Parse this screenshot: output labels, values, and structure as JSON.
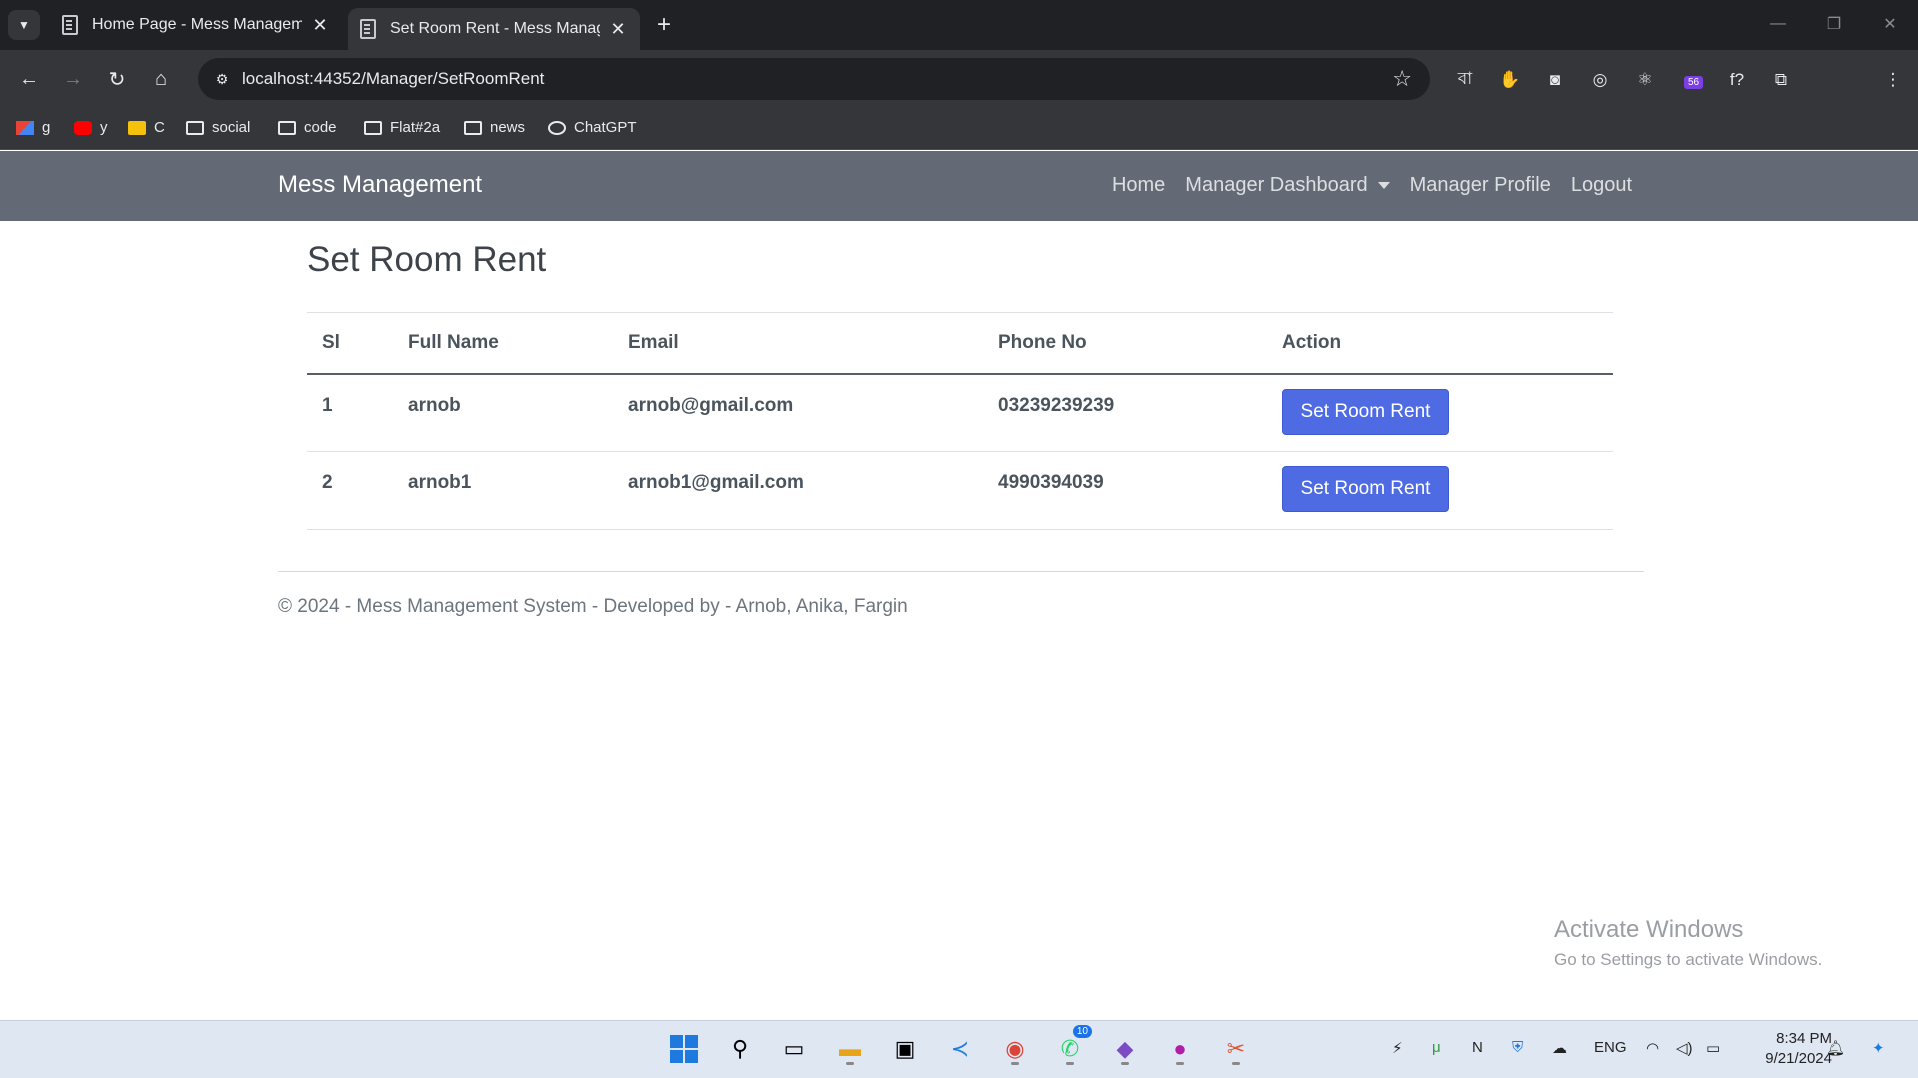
{
  "browser": {
    "tabs": [
      {
        "title": "Home Page - Mess Managemen",
        "active": false
      },
      {
        "title": "Set Room Rent - Mess Manager",
        "active": true
      }
    ],
    "new_tab_symbol": "+",
    "url": "localhost:44352/Manager/SetRoomRent",
    "extension_badge": "56",
    "bookmarks": [
      {
        "label": "g",
        "icon": "gmail-icon"
      },
      {
        "label": "y",
        "icon": "youtube-icon"
      },
      {
        "label": "C",
        "icon": "classroom-icon"
      },
      {
        "label": "social",
        "icon": "folder-icon"
      },
      {
        "label": "code",
        "icon": "folder-icon"
      },
      {
        "label": "Flat#2a",
        "icon": "folder-icon"
      },
      {
        "label": "news",
        "icon": "folder-icon"
      },
      {
        "label": "ChatGPT",
        "icon": "chatgpt-icon"
      }
    ]
  },
  "navbar": {
    "brand": "Mess Management",
    "links": {
      "home": "Home",
      "dashboard": "Manager Dashboard",
      "profile": "Manager Profile",
      "logout": "Logout"
    }
  },
  "page": {
    "title": "Set Room Rent",
    "table": {
      "headers": [
        "Sl",
        "Full Name",
        "Email",
        "Phone No",
        "Action"
      ],
      "rows": [
        {
          "sl": "1",
          "name": "arnob",
          "email": "arnob@gmail.com",
          "phone": "03239239239",
          "action": "Set Room Rent"
        },
        {
          "sl": "2",
          "name": "arnob1",
          "email": "arnob1@gmail.com",
          "phone": "4990394039",
          "action": "Set Room Rent"
        }
      ]
    }
  },
  "footer": {
    "text": "© 2024 - Mess Management System - Developed by - Arnob, Anika, Fargin"
  },
  "watermark": {
    "line1": "Activate Windows",
    "line2": "Go to Settings to activate Windows."
  },
  "taskbar": {
    "whatsapp_badge": "10",
    "lang": "ENG",
    "time": "8:34 PM",
    "date": "9/21/2024"
  },
  "colors": {
    "navbar_bg": "#636a75",
    "button_bg": "#4f6be3",
    "chrome_dark": "#202124"
  }
}
